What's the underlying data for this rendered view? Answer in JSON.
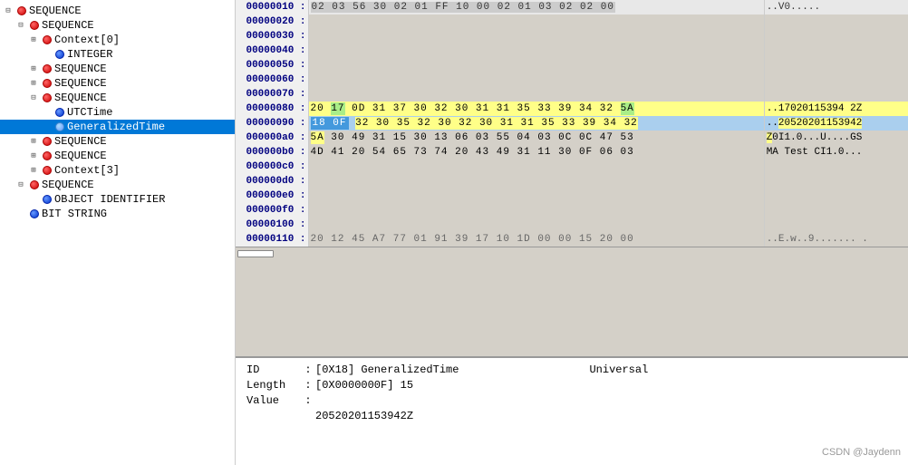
{
  "tree": {
    "items": [
      {
        "id": "seq1",
        "label": "SEQUENCE",
        "indent": 0,
        "expanded": true,
        "dot": "red",
        "hasExpander": true
      },
      {
        "id": "seq2",
        "label": "SEQUENCE",
        "indent": 1,
        "expanded": true,
        "dot": "red",
        "hasExpander": true
      },
      {
        "id": "ctx0",
        "label": "Context[0]",
        "indent": 2,
        "expanded": true,
        "dot": "red",
        "hasExpander": true
      },
      {
        "id": "int1",
        "label": "INTEGER",
        "indent": 3,
        "expanded": false,
        "dot": "blue",
        "hasExpander": false
      },
      {
        "id": "seq3",
        "label": "SEQUENCE",
        "indent": 2,
        "expanded": true,
        "dot": "red",
        "hasExpander": true
      },
      {
        "id": "seq4",
        "label": "SEQUENCE",
        "indent": 2,
        "expanded": true,
        "dot": "red",
        "hasExpander": true
      },
      {
        "id": "seq5",
        "label": "SEQUENCE",
        "indent": 2,
        "expanded": true,
        "dot": "red",
        "hasExpander": true
      },
      {
        "id": "utc",
        "label": "UTCTime",
        "indent": 3,
        "expanded": false,
        "dot": "blue",
        "hasExpander": false
      },
      {
        "id": "gtime",
        "label": "GeneralizedTime",
        "indent": 3,
        "expanded": false,
        "dot": "blue",
        "hasExpander": false,
        "selected": true
      },
      {
        "id": "seq6",
        "label": "SEQUENCE",
        "indent": 2,
        "expanded": true,
        "dot": "red",
        "hasExpander": true
      },
      {
        "id": "seq7",
        "label": "SEQUENCE",
        "indent": 2,
        "expanded": true,
        "dot": "red",
        "hasExpander": true
      },
      {
        "id": "ctx3",
        "label": "Context[3]",
        "indent": 2,
        "expanded": true,
        "dot": "red",
        "hasExpander": true
      },
      {
        "id": "seq8",
        "label": "SEQUENCE",
        "indent": 1,
        "expanded": true,
        "dot": "red",
        "hasExpander": true
      },
      {
        "id": "oid",
        "label": "OBJECT IDENTIFIER",
        "indent": 2,
        "expanded": false,
        "dot": "blue",
        "hasExpander": false
      },
      {
        "id": "bstr",
        "label": "BIT STRING",
        "indent": 1,
        "expanded": false,
        "dot": "blue",
        "hasExpander": false
      }
    ]
  },
  "hex": {
    "rows": [
      {
        "addr": "00000010 :",
        "bytes": "02 03 56 30 02 01 FF 10 00 02 01 03 02 02 00",
        "ascii": "..V0...........",
        "hl": "none"
      },
      {
        "addr": "00000020 :",
        "bytes": "                                             ",
        "ascii": "               ",
        "hl": "none"
      },
      {
        "addr": "00000030 :",
        "bytes": "                                             ",
        "ascii": "               ",
        "hl": "none"
      },
      {
        "addr": "00000040 :",
        "bytes": "                                             ",
        "ascii": "               ",
        "hl": "none"
      },
      {
        "addr": "00000050 :",
        "bytes": "                                             ",
        "ascii": "               ",
        "hl": "none"
      },
      {
        "addr": "00000060 :",
        "bytes": "                                             ",
        "ascii": "               ",
        "hl": "none"
      },
      {
        "addr": "00000070 :",
        "bytes": "                                             ",
        "ascii": "               ",
        "hl": "none"
      },
      {
        "addr": "00000080 :",
        "bytes": "20 17 0D 31 37 30 32 30 31 31 35 33 39 34 32 5A",
        "ascii": "..17020115394 2Z",
        "hl": "yellow"
      },
      {
        "addr": "00000090 :",
        "bytes": "18 0F 32 30 35 32 30 32 30 31 31 35 33 39 34 32",
        "ascii": "..20520201153942",
        "hl": "selected"
      },
      {
        "addr": "000000a0 :",
        "bytes": "5A 30 49 31 15 30 13 06 03 55 04 03 0C 0C 47 53",
        "ascii": "Z0I1.0...U....GS",
        "hl": "none"
      },
      {
        "addr": "000000b0 :",
        "bytes": "4D 41 20 54 65 73 74 20 43 49 31 11 30 0F 06 03",
        "ascii": "MA Test CI1.0...",
        "hl": "none"
      },
      {
        "addr": "000000c0 :",
        "bytes": "                                             ",
        "ascii": "               ",
        "hl": "none"
      },
      {
        "addr": "000000d0 :",
        "bytes": "                                             ",
        "ascii": "               ",
        "hl": "none"
      },
      {
        "addr": "000000e0 :",
        "bytes": "                                             ",
        "ascii": "               ",
        "hl": "none"
      },
      {
        "addr": "000000f0 :",
        "bytes": "                                             ",
        "ascii": "               ",
        "hl": "none"
      },
      {
        "addr": "00000100 :",
        "bytes": "                                             ",
        "ascii": "               ",
        "hl": "none"
      },
      {
        "addr": "00000110 :",
        "bytes": "20 12 45 A7 77 01 91 39 17 10 1D 00 00 15 20 00",
        "ascii": "..E.w..9....... .",
        "hl": "none"
      }
    ]
  },
  "info": {
    "id_label": "ID",
    "id_value": "[0X18] GeneralizedTime",
    "id_class": "Universal",
    "length_label": "Length",
    "length_value": "[0X0000000F] 15",
    "value_label": "Value",
    "value_data": "20520201153942Z"
  },
  "watermark": "CSDN @Jaydenn"
}
